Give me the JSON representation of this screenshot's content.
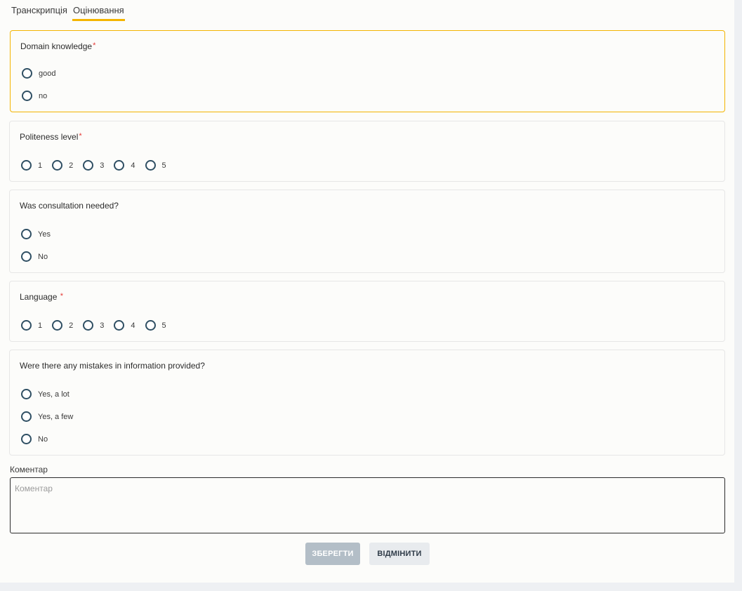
{
  "tabs": [
    {
      "label": "Транскрипція",
      "active": false
    },
    {
      "label": "Оцінювання",
      "active": true
    }
  ],
  "questions": {
    "domain_knowledge": {
      "title": "Domain knowledge",
      "required_mark": "*",
      "options": [
        "good",
        "no"
      ]
    },
    "politeness": {
      "title": "Politeness level",
      "required_mark": "*",
      "options": [
        "1",
        "2",
        "3",
        "4",
        "5"
      ]
    },
    "consultation": {
      "title": "Was consultation needed?",
      "options": [
        "Yes",
        "No"
      ]
    },
    "language": {
      "title": "Language ",
      "required_mark": "*",
      "options": [
        "1",
        "2",
        "3",
        "4",
        "5"
      ]
    },
    "mistakes": {
      "title": "Were there any mistakes in information provided?",
      "options": [
        "Yes, a lot",
        "Yes, a few",
        "No"
      ]
    }
  },
  "comment": {
    "label": "Коментар",
    "placeholder": "Коментар",
    "value": ""
  },
  "actions": {
    "save_label": "ЗБЕРЕГТИ",
    "cancel_label": "ВІДМІНИТИ"
  },
  "colors": {
    "accent": "#f4b400",
    "required": "#e53935",
    "radio_border": "#2f4f63",
    "save_disabled_bg": "#b3bec7",
    "cancel_bg": "#e8ebee"
  },
  "icons": {
    "radio": "radio-unchecked-icon"
  }
}
